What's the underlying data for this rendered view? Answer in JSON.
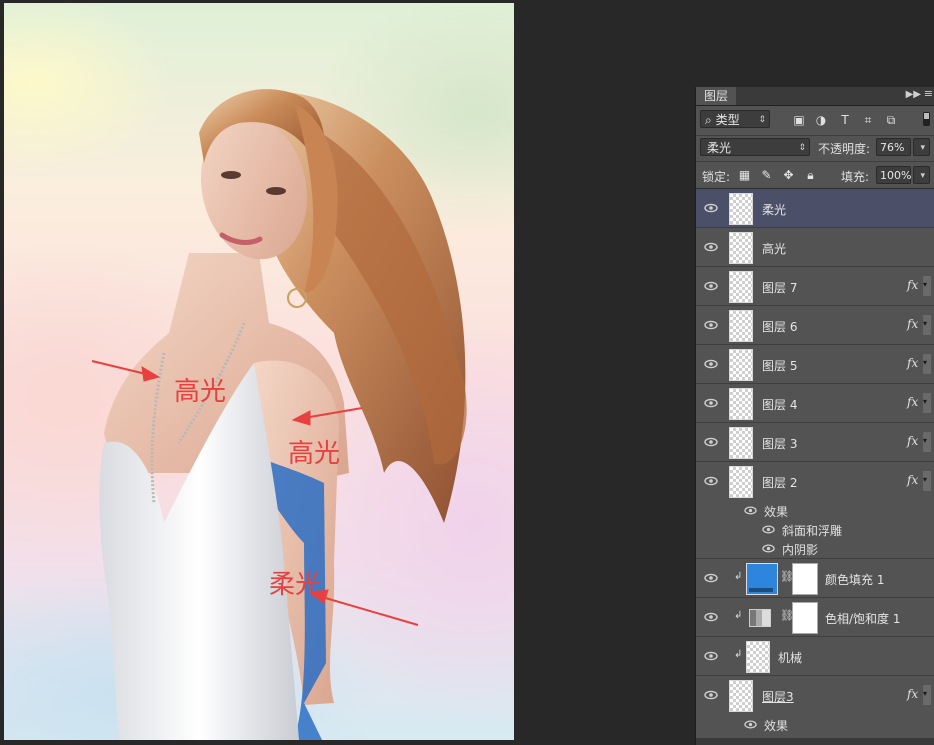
{
  "canvas": {
    "annotations": [
      "高光",
      "高光",
      "柔光"
    ],
    "colors": {
      "arrow": "#e8403e"
    }
  },
  "layers_panel": {
    "tab_label": "图层",
    "filter": {
      "kind_label": "类型",
      "icons": [
        "image-filter-icon",
        "adjustment-filter-icon",
        "type-filter-icon",
        "shape-filter-icon",
        "smart-object-filter-icon"
      ]
    },
    "blend_mode": "柔光",
    "opacity_label": "不透明度:",
    "opacity_value": "76%",
    "lock_label": "锁定:",
    "fill_label": "填充:",
    "fill_value": "100%",
    "layers": [
      {
        "name": "柔光",
        "selected": true,
        "fx": false
      },
      {
        "name": "高光",
        "selected": false,
        "fx": false
      },
      {
        "name": "图层 7",
        "selected": false,
        "fx": true
      },
      {
        "name": "图层 6",
        "selected": false,
        "fx": true
      },
      {
        "name": "图层 5",
        "selected": false,
        "fx": true
      },
      {
        "name": "图层 4",
        "selected": false,
        "fx": true
      },
      {
        "name": "图层 3",
        "selected": false,
        "fx": true
      },
      {
        "name": "图层 2",
        "selected": false,
        "fx": true
      }
    ],
    "layer2_effects": {
      "header": "效果",
      "items": [
        "斜面和浮雕",
        "内阴影"
      ]
    },
    "adjustment_layers": [
      {
        "name": "颜色填充 1",
        "kind": "solid-color-fill",
        "color": "#2d85dd"
      },
      {
        "name": "色相/饱和度 1",
        "kind": "hue-saturation"
      }
    ],
    "smart_layer": {
      "name": "机械"
    },
    "bottom_layer": {
      "name": "图层3",
      "fx": true,
      "effects_header": "效果"
    },
    "fx_label": "fx"
  }
}
